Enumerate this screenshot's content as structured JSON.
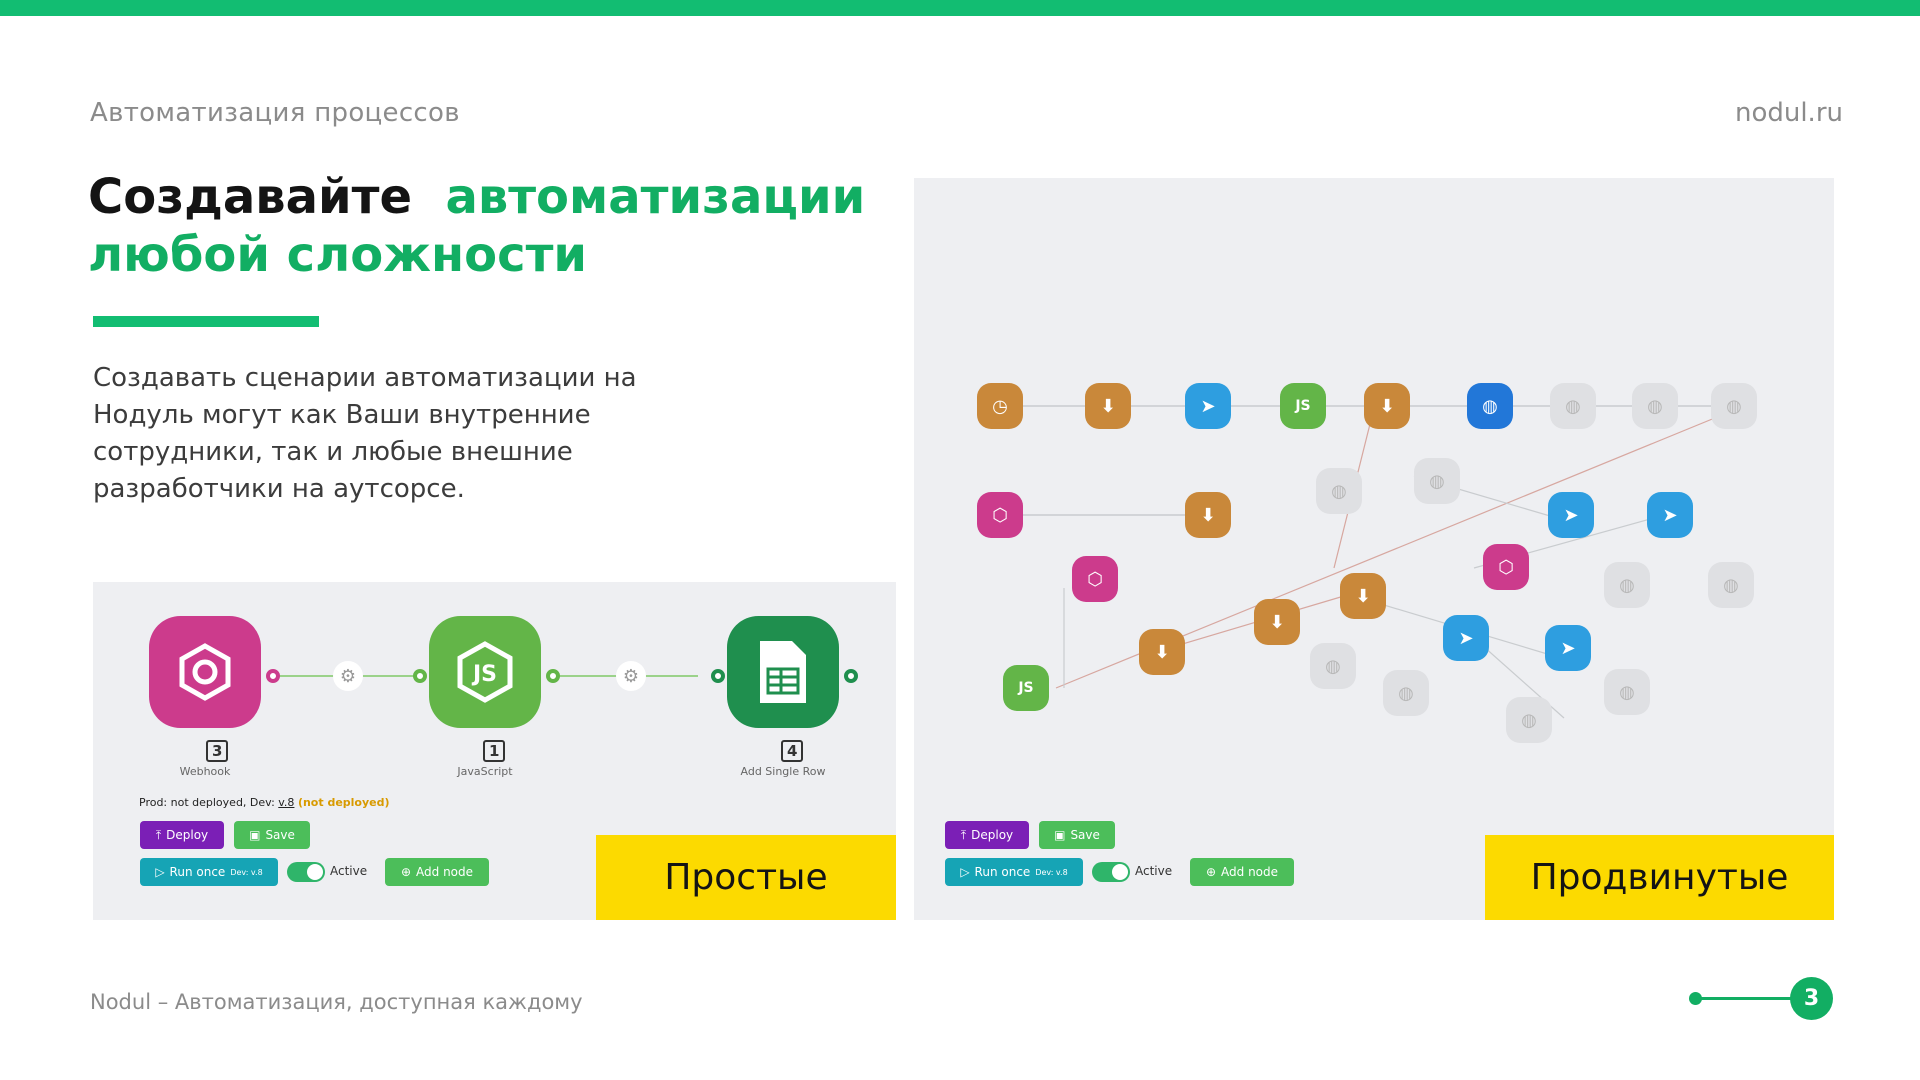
{
  "header": {
    "left": "Автоматизация процессов",
    "right": "nodul.ru"
  },
  "title": {
    "part1": "Создавайте",
    "part2": "автоматизации",
    "line2": "любой сложности"
  },
  "description": "Создавать сценарии автоматизации на Нодуль могут как Ваши внутренние сотрудники, так и любые внешние разработчики на аутсорсе.",
  "simple_panel": {
    "nodes": [
      {
        "icon": "webhook-icon",
        "number": "3",
        "label": "Webhook",
        "color": "#cc3b8c"
      },
      {
        "icon": "javascript-icon",
        "number": "1",
        "label": "JavaScript",
        "color": "#63b548"
      },
      {
        "icon": "spreadsheet-icon",
        "number": "4",
        "label": "Add Single Row",
        "color": "#1f8f4e"
      }
    ],
    "status_prefix": "Prod: not deployed, Dev:",
    "status_version": "v.8",
    "status_suffix": "(not deployed)",
    "deploy": "Deploy",
    "save": "Save",
    "run_once": "Run once",
    "run_once_sup": "Dev: v.8",
    "active": "Active",
    "add_node": "Add node",
    "caption": "Простые"
  },
  "advanced_panel": {
    "deploy": "Deploy",
    "save": "Save",
    "run_once": "Run once",
    "run_once_sup": "Dev: v.8",
    "active": "Active",
    "add_node": "Add node",
    "caption": "Продвинутые"
  },
  "colors": {
    "accent": "#12bd72",
    "deploy": "#7b1fb6",
    "save": "#4cbe5a",
    "run": "#16a4b5",
    "caption_bg": "#fcda00"
  },
  "footer": "Nodul – Автоматизация, доступная каждому",
  "page_number": "3"
}
